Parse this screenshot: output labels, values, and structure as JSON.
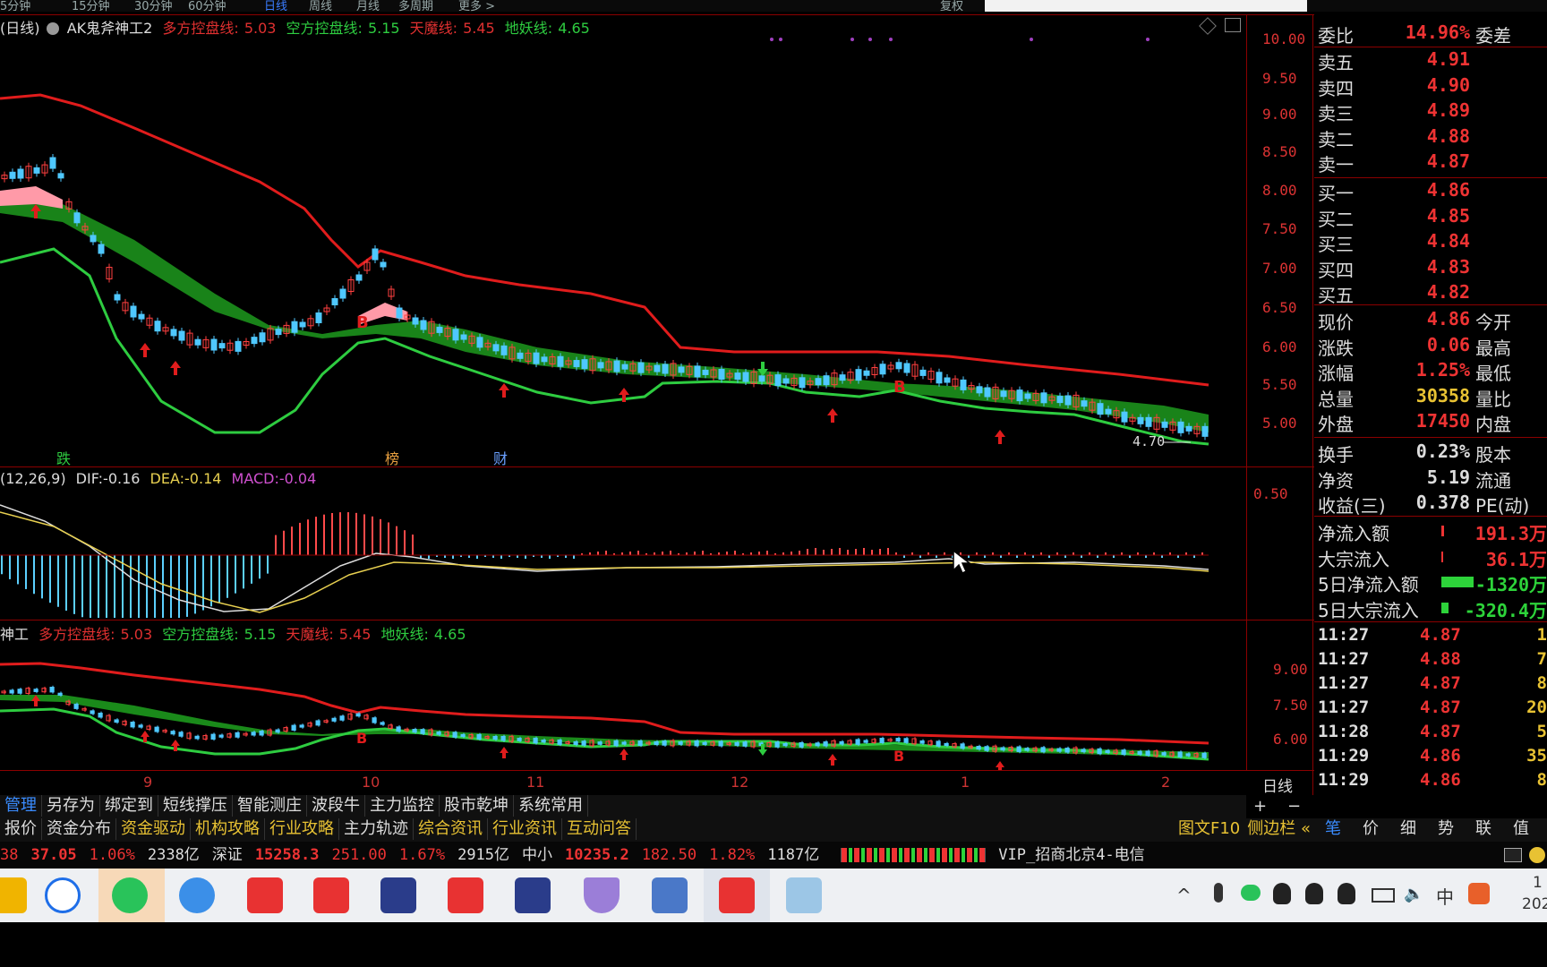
{
  "top_menu": {
    "items": [
      "5分钟",
      "15分钟",
      "30分钟",
      "60分钟",
      "日线",
      "周线",
      "月线",
      "多周期",
      "更多 >"
    ],
    "right_label": "复权"
  },
  "main_chart": {
    "prefix": "(日线)",
    "indicator_name": "AK鬼斧神工2",
    "lines": [
      {
        "label": "多方控盘线:",
        "value": "5.03",
        "color": "#e03030"
      },
      {
        "label": "空方控盘线:",
        "value": "5.15",
        "color": "#2ecc40"
      },
      {
        "label": "天魔线:",
        "value": "5.45",
        "color": "#e03030"
      },
      {
        "label": "地妖线:",
        "value": "4.65",
        "color": "#2ecc40"
      }
    ],
    "y_ticks": [
      "10.00",
      "9.50",
      "9.00",
      "8.50",
      "8.00",
      "7.50",
      "7.00",
      "6.50",
      "6.00",
      "5.50",
      "5.00"
    ],
    "events": [
      {
        "text": "跌",
        "color": "#2ecc40"
      },
      {
        "text": "榜",
        "color": "#e8a040"
      },
      {
        "text": "财",
        "color": "#6aa0ff"
      }
    ],
    "low_label": "4.70",
    "b_marker": "B",
    "upper_line_color": "#e01c1c",
    "lower_line_color": "#2ecc40",
    "band_color": "#1a8a1a",
    "band_pink": "#ff9aa8"
  },
  "macd": {
    "params": "(12,26,9)",
    "dif": {
      "label": "DIF:",
      "value": "-0.16"
    },
    "dea": {
      "label": "DEA:",
      "value": "-0.14"
    },
    "macd": {
      "label": "MACD:",
      "value": "-0.04"
    },
    "y_tick": "0.50"
  },
  "sub_chart": {
    "prefix": "神工",
    "lines": [
      {
        "label": "多方控盘线:",
        "value": "5.03"
      },
      {
        "label": "空方控盘线:",
        "value": "5.15"
      },
      {
        "label": "天魔线:",
        "value": "5.45"
      },
      {
        "label": "地妖线:",
        "value": "4.65"
      }
    ],
    "y_ticks": [
      "9.00",
      "7.50",
      "6.00"
    ]
  },
  "x_axis": {
    "ticks": [
      "9",
      "10",
      "11",
      "12",
      "1",
      "2"
    ],
    "period": "日线"
  },
  "quote": {
    "wei": {
      "label": "委比",
      "value": "14.96%",
      "label2": "委差"
    },
    "sells": [
      {
        "label": "卖五",
        "price": "4.91"
      },
      {
        "label": "卖四",
        "price": "4.90"
      },
      {
        "label": "卖三",
        "price": "4.89"
      },
      {
        "label": "卖二",
        "price": "4.88"
      },
      {
        "label": "卖一",
        "price": "4.87"
      }
    ],
    "buys": [
      {
        "label": "买一",
        "price": "4.86"
      },
      {
        "label": "买二",
        "price": "4.85"
      },
      {
        "label": "买三",
        "price": "4.84"
      },
      {
        "label": "买四",
        "price": "4.83"
      },
      {
        "label": "买五",
        "price": "4.82"
      }
    ],
    "stats": [
      {
        "label": "现价",
        "value": "4.86",
        "label2": "今开",
        "color": "#e33"
      },
      {
        "label": "涨跌",
        "value": "0.06",
        "label2": "最高",
        "color": "#e33"
      },
      {
        "label": "涨幅",
        "value": "1.25%",
        "label2": "最低",
        "color": "#e33"
      },
      {
        "label": "总量",
        "value": "30358",
        "label2": "量比",
        "color": "#e8c233"
      },
      {
        "label": "外盘",
        "value": "17450",
        "label2": "内盘",
        "color": "#e33"
      }
    ],
    "stats2": [
      {
        "label": "换手",
        "value": "0.23%",
        "label2": "股本",
        "color": "#ddd"
      },
      {
        "label": "净资",
        "value": "5.19",
        "label2": "流通",
        "color": "#ddd"
      },
      {
        "label": "收益(三)",
        "value": "0.378",
        "label2": "PE(动)",
        "color": "#ddd"
      }
    ],
    "flows": [
      {
        "label": "净流入额",
        "value": "191.3万",
        "color": "#e33",
        "bar_color": "#e33",
        "bar_width": 3
      },
      {
        "label": "大宗流入",
        "value": "36.1万",
        "color": "#e33",
        "bar_color": "#e33",
        "bar_width": 2
      },
      {
        "label": "5日净流入额",
        "value": "-1320万",
        "color": "#2dd33a",
        "bar_color": "#2dd33a",
        "bar_width": 36
      },
      {
        "label": "5日大宗流入",
        "value": "-320.4万",
        "color": "#2dd33a",
        "bar_color": "#2dd33a",
        "bar_width": 8
      }
    ],
    "ticks": [
      {
        "time": "11:27",
        "price": "4.87",
        "vol": "1"
      },
      {
        "time": "11:27",
        "price": "4.88",
        "vol": "7"
      },
      {
        "time": "11:27",
        "price": "4.87",
        "vol": "8"
      },
      {
        "time": "11:27",
        "price": "4.87",
        "vol": "20"
      },
      {
        "time": "11:28",
        "price": "4.87",
        "vol": "5"
      },
      {
        "time": "11:29",
        "price": "4.86",
        "vol": "35"
      },
      {
        "time": "11:29",
        "price": "4.86",
        "vol": "8"
      }
    ],
    "tabs": [
      "笔",
      "价",
      "细",
      "势",
      "联",
      "值"
    ],
    "zoom": [
      "+",
      "−"
    ]
  },
  "toolbar1": [
    "管理",
    "另存为",
    "绑定到",
    "短线撑压",
    "智能测庄",
    "波段牛",
    "主力监控",
    "股市乾坤",
    "系统常用"
  ],
  "toolbar2": [
    "报价",
    "资金分布",
    "资金驱动",
    "机构攻略",
    "行业攻略",
    "主力轨迹",
    "综合资讯",
    "行业资讯",
    "互动问答"
  ],
  "toolbar2_right": [
    "图文F10",
    "侧边栏 «"
  ],
  "ticker": {
    "segments": [
      {
        "text": "38",
        "color": "#e33"
      },
      {
        "text": "37.05",
        "color": "#e33"
      },
      {
        "text": "1.06%",
        "color": "#e33"
      },
      {
        "text": "2338亿",
        "color": "#ddd"
      },
      {
        "text": "深证",
        "color": "#ddd"
      },
      {
        "text": "15258.3",
        "color": "#e33"
      },
      {
        "text": "251.00",
        "color": "#e33"
      },
      {
        "text": "1.67%",
        "color": "#e33"
      },
      {
        "text": "2915亿",
        "color": "#ddd"
      },
      {
        "text": "中小",
        "color": "#ddd"
      },
      {
        "text": "10235.2",
        "color": "#e33"
      },
      {
        "text": "182.50",
        "color": "#e33"
      },
      {
        "text": "1.82%",
        "color": "#e33"
      },
      {
        "text": "1187亿",
        "color": "#ddd"
      }
    ],
    "server": "VIP_招商北京4-电信"
  },
  "taskbar": {
    "ime": "中",
    "clock_line1": "1",
    "clock_line2": "202"
  }
}
